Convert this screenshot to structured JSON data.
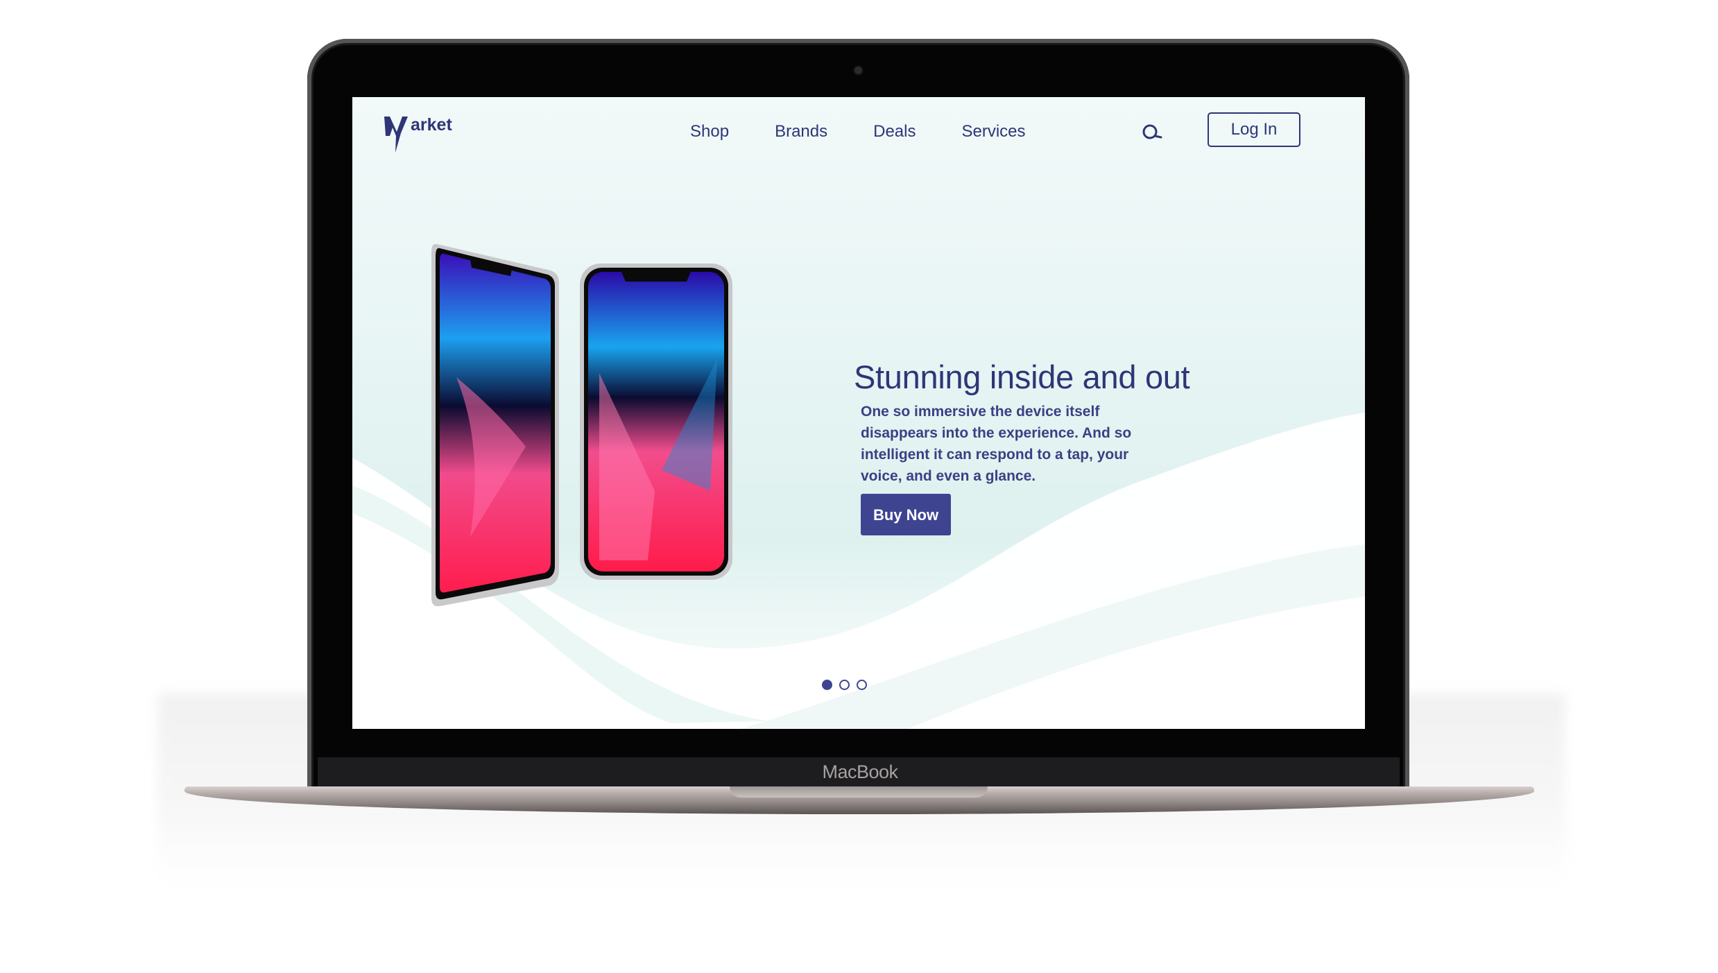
{
  "device": {
    "label": "MacBook"
  },
  "brand": {
    "logo_letter": "M",
    "logo_text": "arket"
  },
  "nav": {
    "items": [
      "Shop",
      "Brands",
      "Deals",
      "Services"
    ]
  },
  "header": {
    "search_icon": "search-icon",
    "login_label": "Log In"
  },
  "hero": {
    "headline": "Stunning inside and out",
    "description": "One so immersive the device itself disappears into the experience. And so intelligent it can respond to a tap, your voice, and even a glance.",
    "cta_label": "Buy Now",
    "image": "two smartphones"
  },
  "carousel": {
    "total": 3,
    "active_index": 0
  },
  "colors": {
    "primary": "#3f4491",
    "text": "#2e3677",
    "background": "#e7f5f4"
  }
}
